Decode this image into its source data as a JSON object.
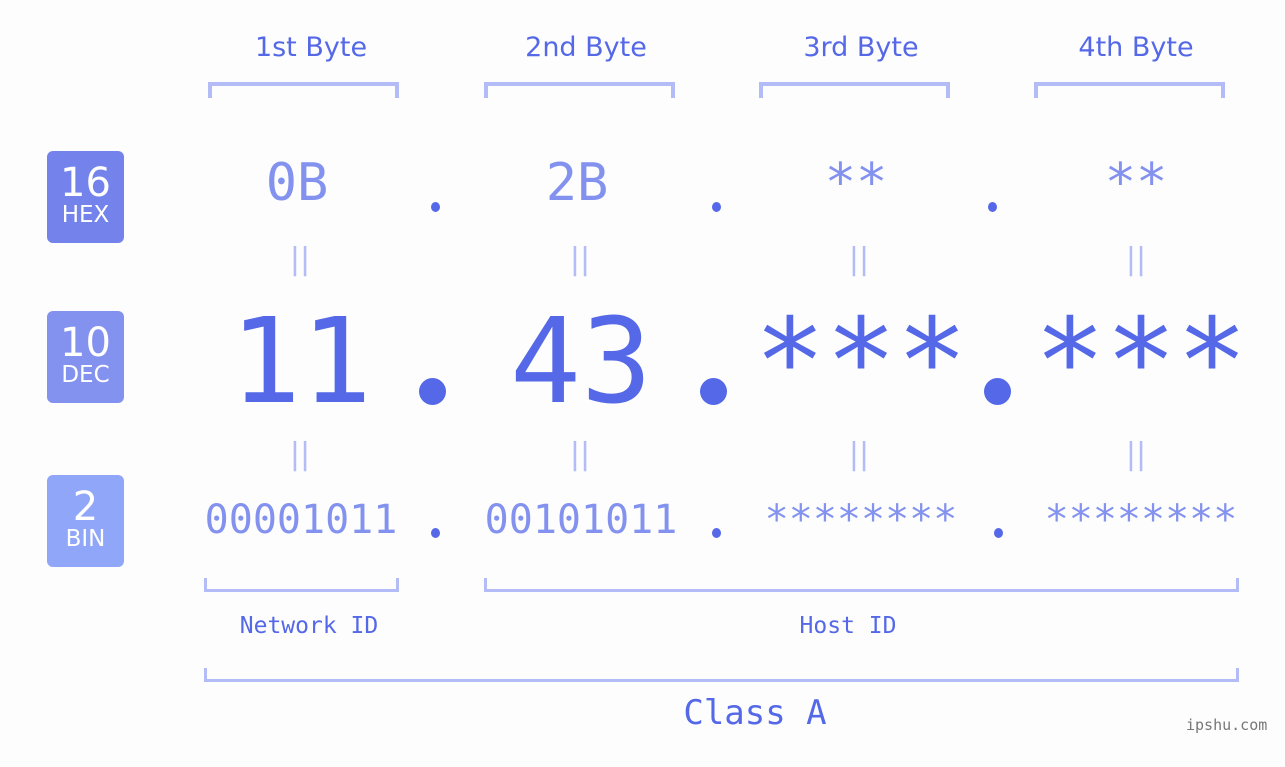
{
  "bytes": [
    {
      "title": "1st Byte",
      "hex": "0B",
      "dec": "11",
      "bin": "00001011"
    },
    {
      "title": "2nd Byte",
      "hex": "2B",
      "dec": "43",
      "bin": "00101011"
    },
    {
      "title": "3rd Byte",
      "hex": "**",
      "dec": "***",
      "bin": "********"
    },
    {
      "title": "4th Byte",
      "hex": "**",
      "dec": "***",
      "bin": "********"
    }
  ],
  "badges": {
    "hex": {
      "num": "16",
      "label": "HEX",
      "color": "#7483ec"
    },
    "dec": {
      "num": "10",
      "label": "DEC",
      "color": "#8391ef"
    },
    "bin": {
      "num": "2",
      "label": "BIN",
      "color": "#8fa6f9"
    }
  },
  "equals_glyph": "||",
  "segments": {
    "network": "Network ID",
    "host": "Host ID",
    "class": "Class A"
  },
  "watermark": "ipshu.com",
  "colors": {
    "primary": "#5468e8",
    "secondary": "#8391ef",
    "bracket": "#b3bcf6"
  }
}
